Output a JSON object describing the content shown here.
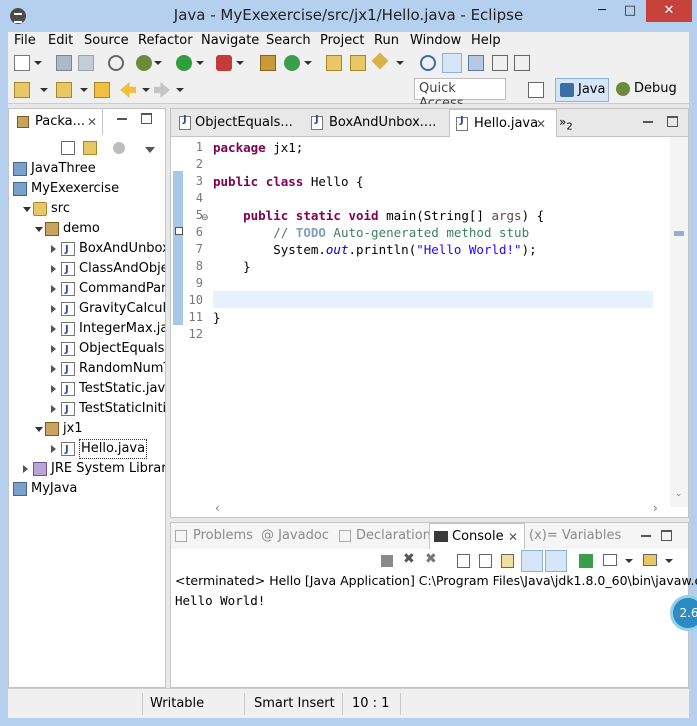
{
  "window": {
    "title": "Java - MyExexercise/src/jx1/Hello.java - Eclipse",
    "minimize": "─",
    "maximize": "□",
    "close": "✕"
  },
  "menubar": [
    "File",
    "Edit",
    "Source",
    "Refactor",
    "Navigate",
    "Search",
    "Project",
    "Run",
    "Window",
    "Help"
  ],
  "toolbar": {
    "quick_access": "Quick Access",
    "perspectives": [
      {
        "label": "Java",
        "active": true,
        "icon": "java-perspective-icon"
      },
      {
        "label": "Debug",
        "active": false,
        "icon": "debug-perspective-icon"
      }
    ]
  },
  "package_explorer": {
    "tab_label": "Packa...",
    "close": "✕",
    "tree": [
      {
        "label": "JavaThree",
        "level": 0,
        "icon": "project-icon",
        "expanded": false
      },
      {
        "label": "MyExexercise",
        "level": 0,
        "icon": "project-icon",
        "expanded": true
      },
      {
        "label": "src",
        "level": 1,
        "icon": "source-folder-icon",
        "expanded": true
      },
      {
        "label": "demo",
        "level": 2,
        "icon": "package-icon",
        "expanded": true
      },
      {
        "label": "BoxAndUnbox",
        "level": 3,
        "icon": "java-file-icon",
        "expanded": false
      },
      {
        "label": "ClassAndObje",
        "level": 3,
        "icon": "java-file-icon",
        "expanded": false
      },
      {
        "label": "CommandPara",
        "level": 3,
        "icon": "java-file-icon",
        "expanded": false
      },
      {
        "label": "GravityCalcula",
        "level": 3,
        "icon": "java-file-icon",
        "expanded": false
      },
      {
        "label": "IntegerMax.ja",
        "level": 3,
        "icon": "java-file-icon",
        "expanded": false
      },
      {
        "label": "ObjectEquals.j",
        "level": 3,
        "icon": "java-file-icon",
        "expanded": false
      },
      {
        "label": "RandomNumT",
        "level": 3,
        "icon": "java-file-icon",
        "expanded": false
      },
      {
        "label": "TestStatic.java",
        "level": 3,
        "icon": "java-file-icon",
        "expanded": false
      },
      {
        "label": "TestStaticIniti",
        "level": 3,
        "icon": "java-file-icon",
        "expanded": false
      },
      {
        "label": "jx1",
        "level": 2,
        "icon": "package-icon",
        "expanded": true
      },
      {
        "label": "Hello.java",
        "level": 3,
        "icon": "java-file-icon",
        "expanded": false,
        "selected": true
      },
      {
        "label": "JRE System Library [",
        "level": 1,
        "icon": "library-icon",
        "expanded": false
      },
      {
        "label": "MyJava",
        "level": 0,
        "icon": "project-icon",
        "expanded": false
      }
    ]
  },
  "editor": {
    "tabs": [
      {
        "label": "ObjectEquals...",
        "active": false
      },
      {
        "label": "BoxAndUnbox....",
        "active": false
      },
      {
        "label": "Hello.java",
        "active": true
      }
    ],
    "overflow_count": "2",
    "line_numbers": [
      "1",
      "2",
      "3",
      "4",
      "5",
      "6",
      "7",
      "8",
      "9",
      "10",
      "11",
      "12"
    ],
    "code": {
      "l1_kw": "package",
      "l1_rest": " jx1;",
      "l3_kw1": "public",
      "l3_kw2": "class",
      "l3_rest": " Hello {",
      "l5_kw1": "public",
      "l5_kw2": "static",
      "l5_kw3": "void",
      "l5_mid": " main(String[] ",
      "l5_param": "args",
      "l5_end": ") {",
      "l6_cm1": "// ",
      "l6_todo": "TODO",
      "l6_cm2": " Auto-generated method stub",
      "l7_a": "System.",
      "l7_fld": "out",
      "l7_b": ".println(",
      "l7_str": "\"Hello World!\"",
      "l7_c": ");",
      "l8": "}",
      "l11": "}"
    }
  },
  "console": {
    "tabs": [
      {
        "label": "Problems",
        "active": false
      },
      {
        "label": "@ Javadoc",
        "active": false
      },
      {
        "label": "Declaration",
        "active": false
      },
      {
        "label": "Console",
        "active": true
      },
      {
        "label": "(x)= Variables",
        "active": false
      }
    ],
    "description": "<terminated> Hello [Java Application] C:\\Program Files\\Java\\jdk1.8.0_60\\bin\\javaw.exe (",
    "output": "Hello World!"
  },
  "status": {
    "writable": "Writable",
    "insert_mode": "Smart Insert",
    "position": "10 : 1"
  },
  "badge": {
    "value": "2.6"
  },
  "colors": {
    "keyword": "#7f0055",
    "comment": "#3f7f5f",
    "string": "#2a00ff",
    "field": "#0000c0",
    "accent": "#b5d0ef"
  }
}
